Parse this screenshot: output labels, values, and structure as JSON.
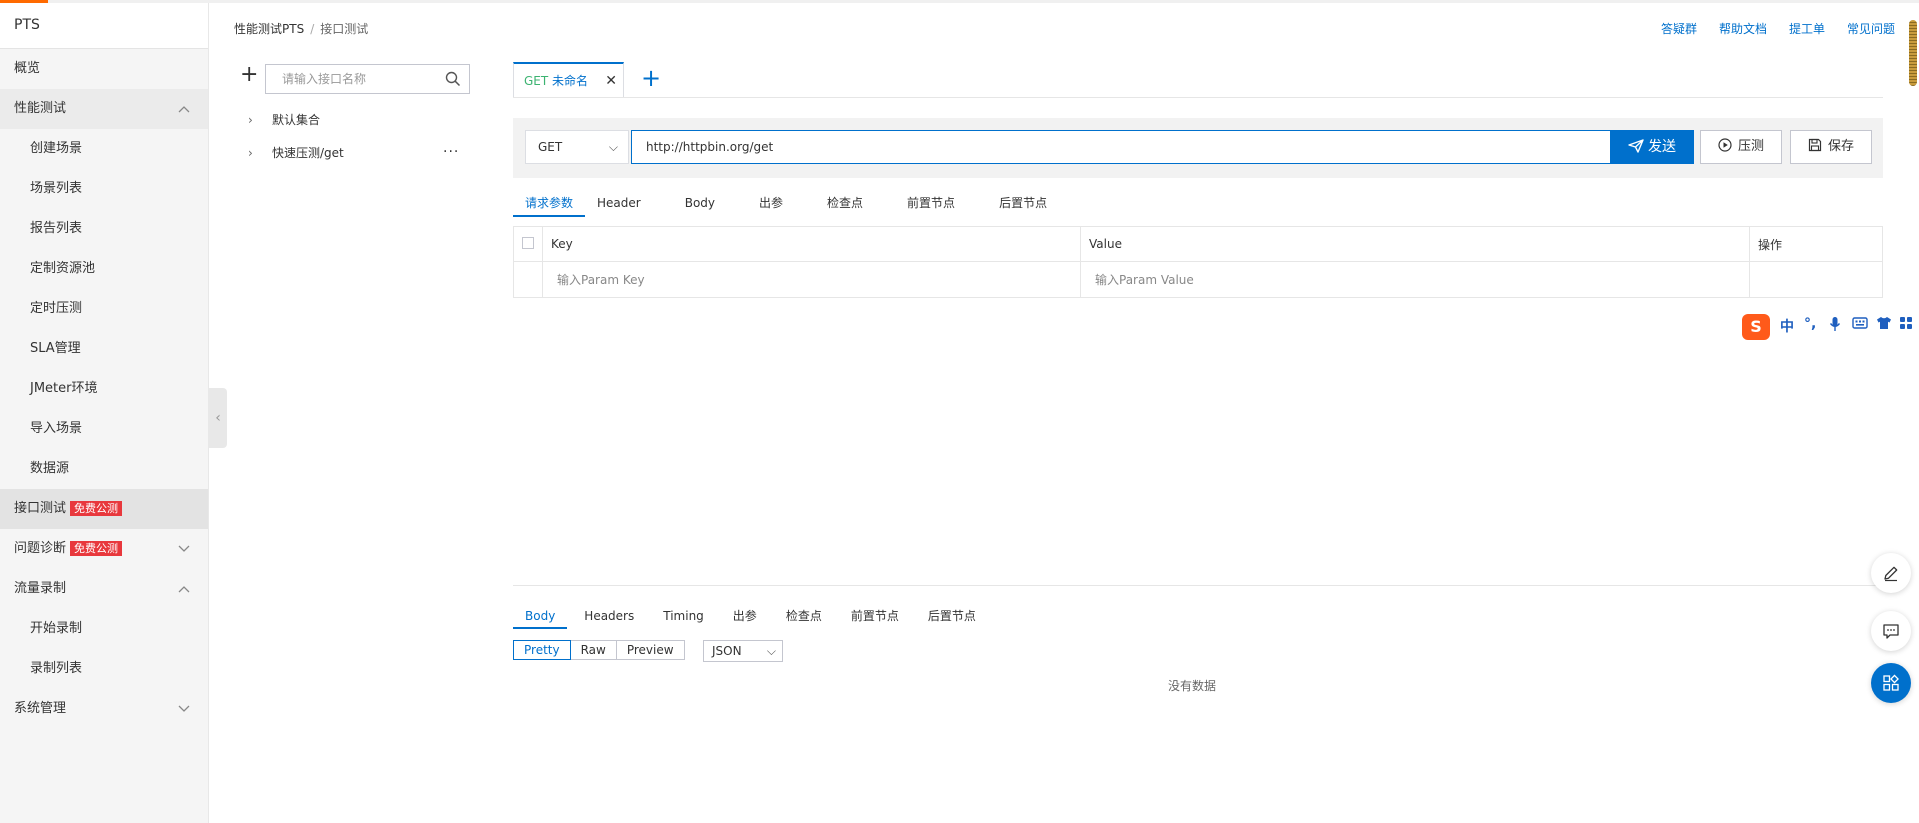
{
  "app": {
    "title": "PTS"
  },
  "sidebar": {
    "items": [
      {
        "label": "概览",
        "type": "item"
      },
      {
        "label": "性能测试",
        "type": "group",
        "chevron": "up"
      },
      {
        "label": "创建场景",
        "type": "sub"
      },
      {
        "label": "场景列表",
        "type": "sub"
      },
      {
        "label": "报告列表",
        "type": "sub"
      },
      {
        "label": "定制资源池",
        "type": "sub"
      },
      {
        "label": "定时压测",
        "type": "sub"
      },
      {
        "label": "SLA管理",
        "type": "sub"
      },
      {
        "label": "JMeter环境",
        "type": "sub"
      },
      {
        "label": "导入场景",
        "type": "sub"
      },
      {
        "label": "数据源",
        "type": "sub"
      },
      {
        "label": "接口测试",
        "type": "active",
        "badge": "免费公测"
      },
      {
        "label": "问题诊断",
        "type": "item",
        "badge": "免费公测",
        "chevron": "down"
      },
      {
        "label": "流量录制",
        "type": "item",
        "chevron": "up"
      },
      {
        "label": "开始录制",
        "type": "sub"
      },
      {
        "label": "录制列表",
        "type": "sub"
      },
      {
        "label": "系统管理",
        "type": "item",
        "chevron": "down"
      }
    ]
  },
  "breadcrumb": {
    "root": "性能测试PTS",
    "separator": "/",
    "current": "接口测试"
  },
  "top_links": [
    "答疑群",
    "帮助文档",
    "提工单",
    "常见问题"
  ],
  "api_list": {
    "add_icon": "plus-icon",
    "search_placeholder": "请输入接口名称",
    "tree": [
      {
        "label": "默认集合"
      },
      {
        "label": "快速压测/get",
        "more": "···"
      }
    ]
  },
  "tab": {
    "method": "GET",
    "name": "未命名",
    "close": "✕",
    "add": "+"
  },
  "request": {
    "method": "GET",
    "url": "http://httpbin.org/get",
    "send_label": "发送",
    "stress_label": "压测",
    "save_label": "保存"
  },
  "request_tabs": [
    "请求参数",
    "Header",
    "Body",
    "出参",
    "检查点",
    "前置节点",
    "后置节点"
  ],
  "params_table": {
    "headers": [
      "Key",
      "Value",
      "操作"
    ],
    "key_placeholder": "输入Param Key",
    "value_placeholder": "输入Param Value"
  },
  "ime": {
    "logo": "S",
    "items": [
      "中",
      "°,",
      "mic-icon",
      "keyboard-icon",
      "shirt-icon",
      "grid-icon"
    ]
  },
  "response_tabs": [
    "Body",
    "Headers",
    "Timing",
    "出参",
    "检查点",
    "前置节点",
    "后置节点"
  ],
  "view_modes": [
    "Pretty",
    "Raw",
    "Preview"
  ],
  "format": "JSON",
  "empty_text": "没有数据",
  "colors": {
    "primary": "#0070cc",
    "badge": "#e8383d",
    "accent": "#ff6a00",
    "get_method": "#3cb371"
  }
}
